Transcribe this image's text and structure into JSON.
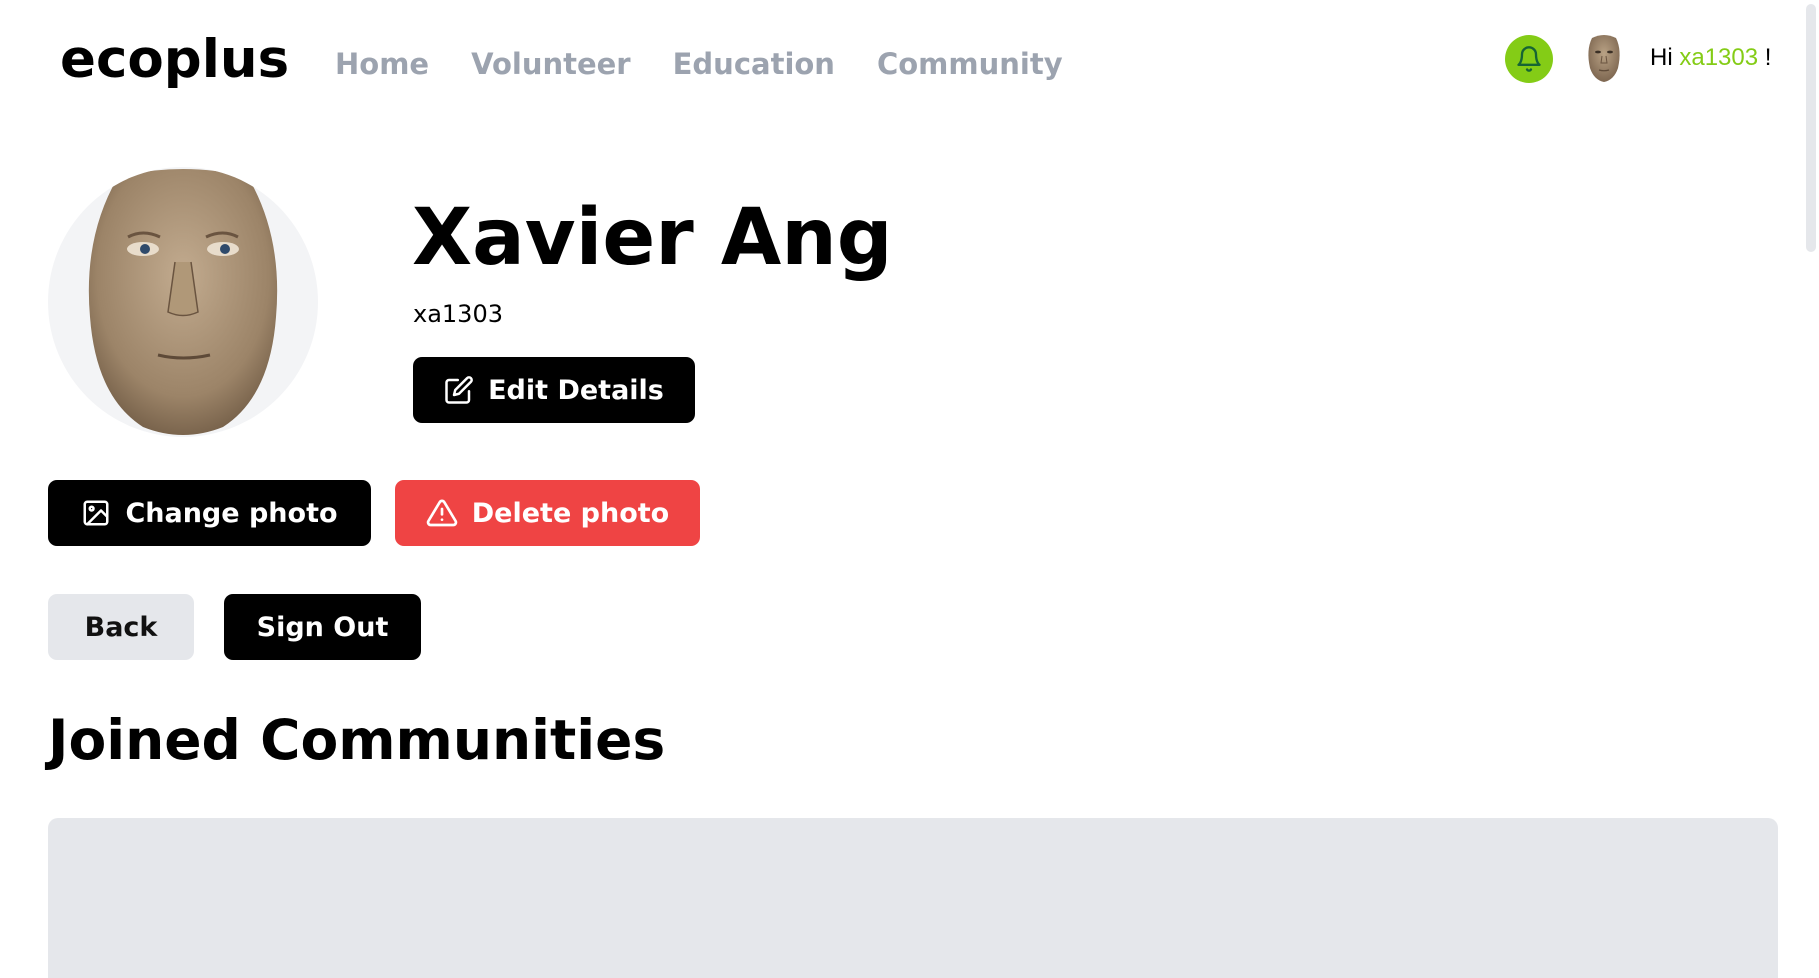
{
  "header": {
    "logo": "ecoplus",
    "nav": [
      "Home",
      "Volunteer",
      "Education",
      "Community"
    ],
    "greeting_prefix": "Hi ",
    "greeting_user": "xa1303",
    "greeting_suffix": " !",
    "icons": {
      "notifications": "bell-icon",
      "avatar": "user-avatar"
    }
  },
  "profile": {
    "full_name": "Xavier Ang",
    "username": "xa1303",
    "edit_label": "Edit Details",
    "change_photo_label": "Change photo",
    "delete_photo_label": "Delete photo",
    "back_label": "Back",
    "sign_out_label": "Sign Out"
  },
  "communities": {
    "title": "Joined Communities"
  },
  "colors": {
    "accent": "#84cc16",
    "danger": "#ef4444",
    "nav_text": "#9ca3af",
    "panel": "#e5e7eb"
  }
}
